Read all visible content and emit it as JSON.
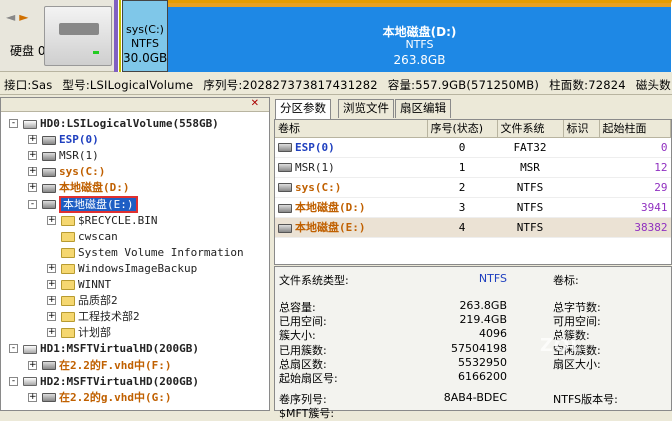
{
  "toolbar": {
    "nav_left": "◄",
    "nav_right": "►",
    "disk_label": "硬盘 0"
  },
  "diskmap": {
    "sys": {
      "name": "sys(C:)",
      "fs": "NTFS",
      "size": "30.0GB"
    },
    "local": {
      "name": "本地磁盘(D:)",
      "fs": "NTFS",
      "size": "263.8GB"
    }
  },
  "infoline": {
    "interface": "接口:Sas",
    "model": "型号:LSILogicalVolume",
    "serial": "序列号:202827373817431282",
    "capacity": "容量:557.9GB(571250MB)",
    "cylinders": "柱面数:72824",
    "heads": "磁头数:255"
  },
  "tree": [
    {
      "text": "HD0:LSILogicalVolume(558GB)",
      "style": "dk",
      "level": 0,
      "toggle": "-",
      "icon": "hd"
    },
    {
      "text": "ESP(0)",
      "style": "bl",
      "level": 1,
      "toggle": "+",
      "icon": "part"
    },
    {
      "text": "MSR(1)",
      "style": "dk",
      "level": 1,
      "toggle": "+",
      "icon": "part"
    },
    {
      "text": "sys(C:)",
      "style": "or",
      "level": 1,
      "toggle": "+",
      "icon": "part"
    },
    {
      "text": "本地磁盘(D:)",
      "style": "or",
      "level": 1,
      "toggle": "+",
      "icon": "part"
    },
    {
      "text": "本地磁盘(E:)",
      "style": "sel",
      "level": 1,
      "toggle": "-",
      "icon": "part"
    },
    {
      "text": "$RECYCLE.BIN",
      "style": "dk",
      "level": 2,
      "toggle": "+",
      "icon": "fold"
    },
    {
      "text": "cwscan",
      "style": "dk",
      "level": 2,
      "toggle": "",
      "icon": "fold"
    },
    {
      "text": "System Volume Information",
      "style": "dk",
      "level": 2,
      "toggle": "",
      "icon": "fold"
    },
    {
      "text": "WindowsImageBackup",
      "style": "dk",
      "level": 2,
      "toggle": "+",
      "icon": "fold"
    },
    {
      "text": "WINNT",
      "style": "dk",
      "level": 2,
      "toggle": "+",
      "icon": "fold"
    },
    {
      "text": "品质部2",
      "style": "dk",
      "level": 2,
      "toggle": "+",
      "icon": "fold"
    },
    {
      "text": "工程技术部2",
      "style": "dk",
      "level": 2,
      "toggle": "+",
      "icon": "fold"
    },
    {
      "text": "计划部",
      "style": "dk",
      "level": 2,
      "toggle": "+",
      "icon": "fold"
    },
    {
      "text": "HD1:MSFTVirtualHD(200GB)",
      "style": "dk",
      "level": 0,
      "toggle": "-",
      "icon": "hd"
    },
    {
      "text": "在2.2的F.vhd中(F:)",
      "style": "or",
      "level": 1,
      "toggle": "+",
      "icon": "part"
    },
    {
      "text": "HD2:MSFTVirtualHD(200GB)",
      "style": "dk",
      "level": 0,
      "toggle": "-",
      "icon": "hd"
    },
    {
      "text": "在2.2的g.vhd中(G:)",
      "style": "or",
      "level": 1,
      "toggle": "+",
      "icon": "part"
    }
  ],
  "tabs": [
    "分区参数",
    "浏览文件",
    "扇区编辑"
  ],
  "table": {
    "headers": [
      "卷标",
      "序号(状态)",
      "文件系统",
      "标识",
      "起始柱面"
    ],
    "rows": [
      {
        "label": "ESP(0)",
        "style": "bl",
        "index": "0",
        "fs": "FAT32",
        "id": "",
        "start": "0"
      },
      {
        "label": "MSR(1)",
        "style": "dk",
        "index": "1",
        "fs": "MSR",
        "id": "",
        "start": "12"
      },
      {
        "label": "sys(C:)",
        "style": "or",
        "index": "2",
        "fs": "NTFS",
        "id": "",
        "start": "29"
      },
      {
        "label": "本地磁盘(D:)",
        "style": "or",
        "index": "3",
        "fs": "NTFS",
        "id": "",
        "start": "3941"
      },
      {
        "label": "本地磁盘(E:)",
        "style": "or",
        "index": "4",
        "fs": "NTFS",
        "id": "",
        "start": "38382"
      }
    ]
  },
  "fsinfo": {
    "fs_type_label": "文件系统类型:",
    "fs_type": "NTFS",
    "volume_label": "卷标:",
    "left": [
      {
        "k": "总容量:",
        "v": "263.8GB"
      },
      {
        "k": "已用空间:",
        "v": "219.4GB"
      },
      {
        "k": "簇大小:",
        "v": "4096"
      },
      {
        "k": "已用簇数:",
        "v": "57504198"
      },
      {
        "k": "总扇区数:",
        "v": "5532950"
      },
      {
        "k": "起始扇区号:",
        "v": "6166200"
      }
    ],
    "right": [
      "总字节数:",
      "可用空间:",
      "总簇数:",
      "空闲簇数:",
      "扇区大小:",
      ""
    ],
    "serial_label": "卷序列号:",
    "serial": "8AB4-BDEC",
    "ntfs_version": "NTFS版本号:",
    "mft_label": "$MFT簇号:"
  },
  "watermark": "ZOL"
}
